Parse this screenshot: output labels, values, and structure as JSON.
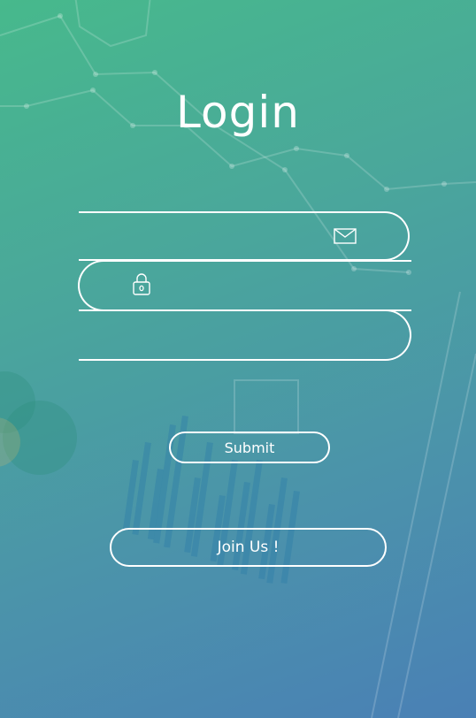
{
  "login": {
    "title": "Login",
    "fields": {
      "email": {
        "value": "",
        "placeholder": "",
        "icon": "mail-icon"
      },
      "password": {
        "value": "",
        "placeholder": "",
        "icon": "lock-icon"
      },
      "confirm": {
        "value": "",
        "placeholder": ""
      }
    },
    "submit_label": "Submit",
    "join_label": "Join Us !"
  },
  "colors": {
    "gradient_start": "#47b98c",
    "gradient_end": "#4a80b5",
    "outline": "#ffffff"
  }
}
